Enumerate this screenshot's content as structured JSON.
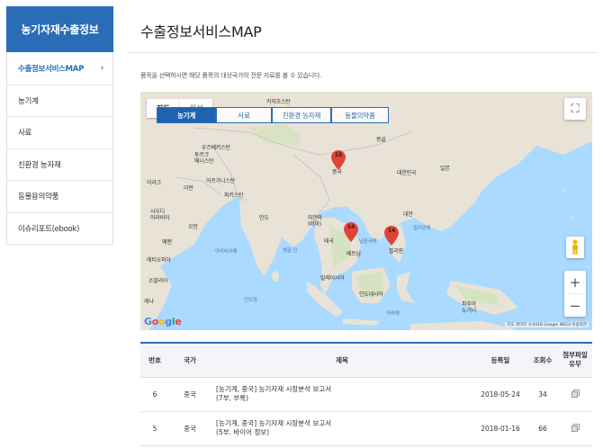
{
  "sidebar": {
    "title": "농기자재수출정보",
    "items": [
      {
        "label": "수출정보서비스MAP",
        "active": true
      },
      {
        "label": "농기계"
      },
      {
        "label": "사료"
      },
      {
        "label": "친환경 농자재"
      },
      {
        "label": "동물용의약품"
      },
      {
        "label": "이슈리포트(ebook)"
      }
    ],
    "active_chevron": "›"
  },
  "main": {
    "title": "수출정보서비스MAP",
    "description": "품목을 선택하시면 해당 품목의 대상국가의 전문 자료를 볼 수 있습니다."
  },
  "map": {
    "map_types": [
      "지도",
      "위성"
    ],
    "tabs": [
      "농기계",
      "사료",
      "친환경 농자재",
      "동물의약품"
    ],
    "active_tab": "농기계",
    "pins": [
      {
        "count": "15",
        "country": "중국"
      },
      {
        "count": "14",
        "country": "베트남"
      },
      {
        "count": "14",
        "country": "필리핀"
      }
    ],
    "labels": {
      "kazakhstan": "카자흐스탄",
      "uzbekistan": "우즈베키스탄",
      "turkmenistan": "투르크\n메니스탄",
      "mongolia": "몽골",
      "china": "중국",
      "korea": "대한민국",
      "japan": "일본",
      "iran": "이란",
      "afghanistan": "아프가니스탄",
      "pakistan": "파키스탄",
      "iraq": "이라크",
      "saudi": "사우디\n아라비아",
      "india": "인도",
      "oman": "오만",
      "yemen": "예멘",
      "myanmar": "미얀마\n(버마)",
      "thailand": "태국",
      "vietnam": "베트남",
      "philippines": "필리핀",
      "malaysia": "말레이시아",
      "indonesia": "인도네시아",
      "somalia": "소말리아",
      "ethiopia": "에티오피아",
      "kenya": "케냐",
      "taiwan": "대만",
      "png": "파푸아\n뉴기니",
      "arabian_sea": "아라비아해",
      "bay_bengal": "벵골 만",
      "south_china_sea": "남중국해",
      "philippine_sea": "필리핀해",
      "indian_ocean": "인도양",
      "java_sea": "자바해"
    },
    "google": "Google",
    "attribution": "지도 데이터 ©2018 Google INEGI  이용약관",
    "fullscreen_icon": "⛶",
    "zoom_in": "+",
    "zoom_out": "−"
  },
  "table": {
    "headers": [
      "번호",
      "국가",
      "제목",
      "등록일",
      "조회수",
      "첨부파일\n유무"
    ],
    "rows": [
      {
        "no": "6",
        "country": "중국",
        "title_line1": "[농기계, 중국] 농기자재 시장분석 보고서",
        "title_line2": "(7부, 부록)",
        "date": "2018-05-24",
        "views": "34"
      },
      {
        "no": "5",
        "country": "중국",
        "title_line1": "[농기계, 중국] 농기자재 시장분석 보고서",
        "title_line2": "(5부. 바이어 정보)",
        "date": "2018-01-16",
        "views": "66"
      }
    ]
  },
  "colors": {
    "accent": "#2a6db6",
    "pin": "#e04237",
    "water": "#aadaff",
    "land": "#e8e3d6"
  }
}
